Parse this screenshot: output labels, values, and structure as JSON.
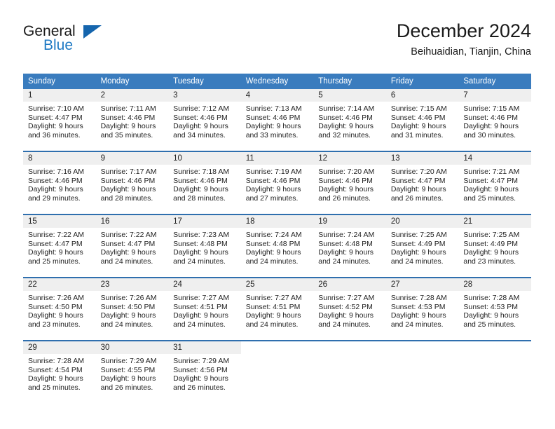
{
  "brand": {
    "name_part1": "General",
    "name_part2": "Blue"
  },
  "header": {
    "title": "December 2024",
    "subtitle": "Beihuaidian, Tianjin, China"
  },
  "colors": {
    "header_blue": "#3a7cbe",
    "separator_blue": "#2f6fae",
    "daynum_gray": "#efefef",
    "logo_blue": "#1f7ac4"
  },
  "weekdays": [
    "Sunday",
    "Monday",
    "Tuesday",
    "Wednesday",
    "Thursday",
    "Friday",
    "Saturday"
  ],
  "weeks": [
    [
      {
        "day": "1",
        "sunrise": "Sunrise: 7:10 AM",
        "sunset": "Sunset: 4:47 PM",
        "daylight1": "Daylight: 9 hours",
        "daylight2": "and 36 minutes."
      },
      {
        "day": "2",
        "sunrise": "Sunrise: 7:11 AM",
        "sunset": "Sunset: 4:46 PM",
        "daylight1": "Daylight: 9 hours",
        "daylight2": "and 35 minutes."
      },
      {
        "day": "3",
        "sunrise": "Sunrise: 7:12 AM",
        "sunset": "Sunset: 4:46 PM",
        "daylight1": "Daylight: 9 hours",
        "daylight2": "and 34 minutes."
      },
      {
        "day": "4",
        "sunrise": "Sunrise: 7:13 AM",
        "sunset": "Sunset: 4:46 PM",
        "daylight1": "Daylight: 9 hours",
        "daylight2": "and 33 minutes."
      },
      {
        "day": "5",
        "sunrise": "Sunrise: 7:14 AM",
        "sunset": "Sunset: 4:46 PM",
        "daylight1": "Daylight: 9 hours",
        "daylight2": "and 32 minutes."
      },
      {
        "day": "6",
        "sunrise": "Sunrise: 7:15 AM",
        "sunset": "Sunset: 4:46 PM",
        "daylight1": "Daylight: 9 hours",
        "daylight2": "and 31 minutes."
      },
      {
        "day": "7",
        "sunrise": "Sunrise: 7:15 AM",
        "sunset": "Sunset: 4:46 PM",
        "daylight1": "Daylight: 9 hours",
        "daylight2": "and 30 minutes."
      }
    ],
    [
      {
        "day": "8",
        "sunrise": "Sunrise: 7:16 AM",
        "sunset": "Sunset: 4:46 PM",
        "daylight1": "Daylight: 9 hours",
        "daylight2": "and 29 minutes."
      },
      {
        "day": "9",
        "sunrise": "Sunrise: 7:17 AM",
        "sunset": "Sunset: 4:46 PM",
        "daylight1": "Daylight: 9 hours",
        "daylight2": "and 28 minutes."
      },
      {
        "day": "10",
        "sunrise": "Sunrise: 7:18 AM",
        "sunset": "Sunset: 4:46 PM",
        "daylight1": "Daylight: 9 hours",
        "daylight2": "and 28 minutes."
      },
      {
        "day": "11",
        "sunrise": "Sunrise: 7:19 AM",
        "sunset": "Sunset: 4:46 PM",
        "daylight1": "Daylight: 9 hours",
        "daylight2": "and 27 minutes."
      },
      {
        "day": "12",
        "sunrise": "Sunrise: 7:20 AM",
        "sunset": "Sunset: 4:46 PM",
        "daylight1": "Daylight: 9 hours",
        "daylight2": "and 26 minutes."
      },
      {
        "day": "13",
        "sunrise": "Sunrise: 7:20 AM",
        "sunset": "Sunset: 4:47 PM",
        "daylight1": "Daylight: 9 hours",
        "daylight2": "and 26 minutes."
      },
      {
        "day": "14",
        "sunrise": "Sunrise: 7:21 AM",
        "sunset": "Sunset: 4:47 PM",
        "daylight1": "Daylight: 9 hours",
        "daylight2": "and 25 minutes."
      }
    ],
    [
      {
        "day": "15",
        "sunrise": "Sunrise: 7:22 AM",
        "sunset": "Sunset: 4:47 PM",
        "daylight1": "Daylight: 9 hours",
        "daylight2": "and 25 minutes."
      },
      {
        "day": "16",
        "sunrise": "Sunrise: 7:22 AM",
        "sunset": "Sunset: 4:47 PM",
        "daylight1": "Daylight: 9 hours",
        "daylight2": "and 24 minutes."
      },
      {
        "day": "17",
        "sunrise": "Sunrise: 7:23 AM",
        "sunset": "Sunset: 4:48 PM",
        "daylight1": "Daylight: 9 hours",
        "daylight2": "and 24 minutes."
      },
      {
        "day": "18",
        "sunrise": "Sunrise: 7:24 AM",
        "sunset": "Sunset: 4:48 PM",
        "daylight1": "Daylight: 9 hours",
        "daylight2": "and 24 minutes."
      },
      {
        "day": "19",
        "sunrise": "Sunrise: 7:24 AM",
        "sunset": "Sunset: 4:48 PM",
        "daylight1": "Daylight: 9 hours",
        "daylight2": "and 24 minutes."
      },
      {
        "day": "20",
        "sunrise": "Sunrise: 7:25 AM",
        "sunset": "Sunset: 4:49 PM",
        "daylight1": "Daylight: 9 hours",
        "daylight2": "and 24 minutes."
      },
      {
        "day": "21",
        "sunrise": "Sunrise: 7:25 AM",
        "sunset": "Sunset: 4:49 PM",
        "daylight1": "Daylight: 9 hours",
        "daylight2": "and 23 minutes."
      }
    ],
    [
      {
        "day": "22",
        "sunrise": "Sunrise: 7:26 AM",
        "sunset": "Sunset: 4:50 PM",
        "daylight1": "Daylight: 9 hours",
        "daylight2": "and 23 minutes."
      },
      {
        "day": "23",
        "sunrise": "Sunrise: 7:26 AM",
        "sunset": "Sunset: 4:50 PM",
        "daylight1": "Daylight: 9 hours",
        "daylight2": "and 24 minutes."
      },
      {
        "day": "24",
        "sunrise": "Sunrise: 7:27 AM",
        "sunset": "Sunset: 4:51 PM",
        "daylight1": "Daylight: 9 hours",
        "daylight2": "and 24 minutes."
      },
      {
        "day": "25",
        "sunrise": "Sunrise: 7:27 AM",
        "sunset": "Sunset: 4:51 PM",
        "daylight1": "Daylight: 9 hours",
        "daylight2": "and 24 minutes."
      },
      {
        "day": "26",
        "sunrise": "Sunrise: 7:27 AM",
        "sunset": "Sunset: 4:52 PM",
        "daylight1": "Daylight: 9 hours",
        "daylight2": "and 24 minutes."
      },
      {
        "day": "27",
        "sunrise": "Sunrise: 7:28 AM",
        "sunset": "Sunset: 4:53 PM",
        "daylight1": "Daylight: 9 hours",
        "daylight2": "and 24 minutes."
      },
      {
        "day": "28",
        "sunrise": "Sunrise: 7:28 AM",
        "sunset": "Sunset: 4:53 PM",
        "daylight1": "Daylight: 9 hours",
        "daylight2": "and 25 minutes."
      }
    ],
    [
      {
        "day": "29",
        "sunrise": "Sunrise: 7:28 AM",
        "sunset": "Sunset: 4:54 PM",
        "daylight1": "Daylight: 9 hours",
        "daylight2": "and 25 minutes."
      },
      {
        "day": "30",
        "sunrise": "Sunrise: 7:29 AM",
        "sunset": "Sunset: 4:55 PM",
        "daylight1": "Daylight: 9 hours",
        "daylight2": "and 26 minutes."
      },
      {
        "day": "31",
        "sunrise": "Sunrise: 7:29 AM",
        "sunset": "Sunset: 4:56 PM",
        "daylight1": "Daylight: 9 hours",
        "daylight2": "and 26 minutes."
      },
      {
        "day": "",
        "sunrise": "",
        "sunset": "",
        "daylight1": "",
        "daylight2": ""
      },
      {
        "day": "",
        "sunrise": "",
        "sunset": "",
        "daylight1": "",
        "daylight2": ""
      },
      {
        "day": "",
        "sunrise": "",
        "sunset": "",
        "daylight1": "",
        "daylight2": ""
      },
      {
        "day": "",
        "sunrise": "",
        "sunset": "",
        "daylight1": "",
        "daylight2": ""
      }
    ]
  ]
}
